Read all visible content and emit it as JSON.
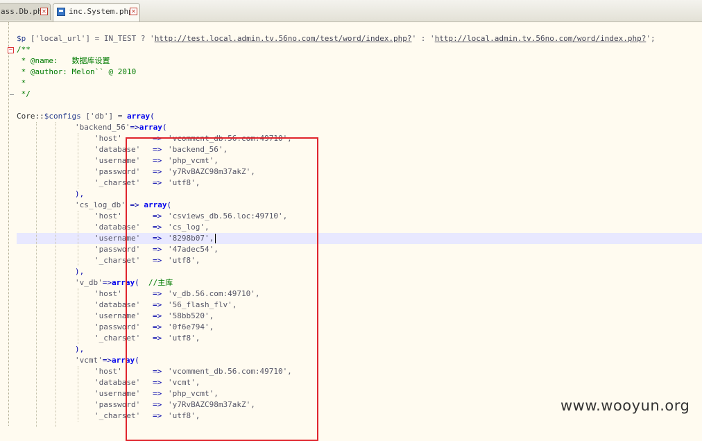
{
  "tabs": [
    {
      "label": "ass.Db.php",
      "active": false
    },
    {
      "label": "inc.System.php",
      "active": true
    }
  ],
  "code": {
    "line_url": {
      "var": "$p",
      "key": " ['local_url'] = IN_TEST ? '",
      "url1": "http://test.local.admin.tv.56no.com/test/word/index.php?",
      "mid": "' : '",
      "url2": "http://local.admin.tv.56no.com/word/index.php?",
      "end": "';"
    },
    "doc_open": "/**",
    "doc_name": " * @name:   数据库设置",
    "doc_author": " * @author: Melon`` @ 2010",
    "doc_star": " *",
    "doc_close": " */",
    "core_line": {
      "a": "Core::",
      "b": "$configs",
      "c": " ['db'] = ",
      "d": "array",
      "e": "("
    },
    "groups": [
      {
        "header_key": "'backend_56'",
        "header_arrow": "=>",
        "header_array": "array",
        "header_paren": "(",
        "comment": "",
        "rows": [
          {
            "key": "'host'     ",
            "arrow": "=>",
            "value": "'vcomment_db.56.com:49710',"
          },
          {
            "key": "'database' ",
            "arrow": "=>",
            "value": "'backend_56',"
          },
          {
            "key": "'username' ",
            "arrow": "=>",
            "value": "'php_vcmt',"
          },
          {
            "key": "'password' ",
            "arrow": "=>",
            "value": "'y7RvBAZC98m37akZ',"
          },
          {
            "key": "'_charset' ",
            "arrow": "=>",
            "value": "'utf8',"
          }
        ],
        "close": "),"
      },
      {
        "header_key": "'cs_log_db'",
        "header_arrow": " => ",
        "header_array": "array",
        "header_paren": "(",
        "comment": "",
        "rows": [
          {
            "key": "'host'     ",
            "arrow": "=>",
            "value": "'csviews_db.56.loc:49710',"
          },
          {
            "key": "'database' ",
            "arrow": "=>",
            "value": "'cs_log',"
          },
          {
            "key": "'username' ",
            "arrow": "=>",
            "value": "'8298b07',"
          },
          {
            "key": "'password' ",
            "arrow": "=>",
            "value": "'47adec54',"
          },
          {
            "key": "'_charset' ",
            "arrow": "=>",
            "value": "'utf8',"
          }
        ],
        "close": "),"
      },
      {
        "header_key": "'v_db'",
        "header_arrow": "=>",
        "header_array": "array",
        "header_paren": "(",
        "comment": "  //主库",
        "rows": [
          {
            "key": "'host'     ",
            "arrow": "=>",
            "value": "'v_db.56.com:49710',"
          },
          {
            "key": "'database' ",
            "arrow": "=>",
            "value": "'56_flash_flv',"
          },
          {
            "key": "'username' ",
            "arrow": "=>",
            "value": "'58bb520',"
          },
          {
            "key": "'password' ",
            "arrow": "=>",
            "value": "'0f6e794',"
          },
          {
            "key": "'_charset' ",
            "arrow": "=>",
            "value": "'utf8',"
          }
        ],
        "close": "),"
      },
      {
        "header_key": "'vcmt'",
        "header_arrow": "=>",
        "header_array": "array",
        "header_paren": "(",
        "comment": "",
        "rows": [
          {
            "key": "'host'     ",
            "arrow": "=>",
            "value": "'vcomment_db.56.com:49710',"
          },
          {
            "key": "'database' ",
            "arrow": "=>",
            "value": "'vcmt',"
          },
          {
            "key": "'username' ",
            "arrow": "=>",
            "value": "'php_vcmt',"
          },
          {
            "key": "'password' ",
            "arrow": "=>",
            "value": "'y7RvBAZC98m37akZ',"
          },
          {
            "key": "'_charset' ",
            "arrow": "=>",
            "value": "'utf8',"
          }
        ],
        "close": ""
      }
    ]
  },
  "watermark": "www.wooyun.org",
  "colors": {
    "highlight_box": "#e0242c",
    "editor_bg": "#fffbf0",
    "current_line": "#e8e8ff"
  }
}
